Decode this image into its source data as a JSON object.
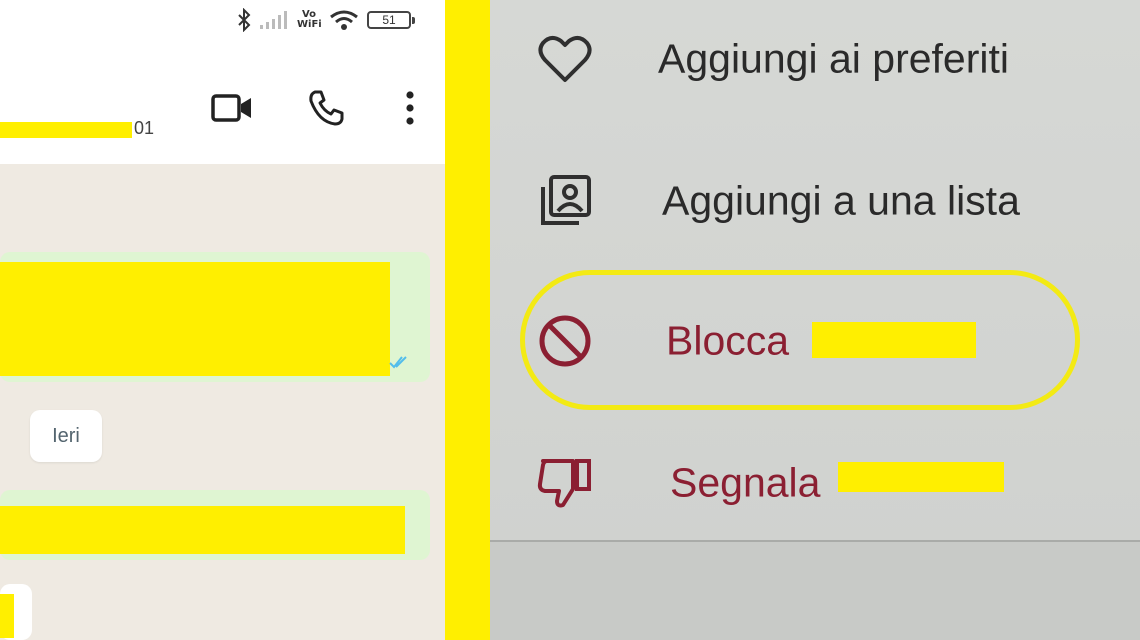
{
  "status_bar": {
    "vowifi_top": "Vo",
    "vowifi_bottom": "WiFi",
    "battery": "51"
  },
  "chat_header": {
    "contact_suffix": "01",
    "icons": [
      "videocam-icon",
      "phone-icon",
      "more-vert-icon"
    ]
  },
  "chat": {
    "date_chip": "Ieri"
  },
  "menu": {
    "items": [
      {
        "label": "Aggiungi ai preferiti",
        "icon": "heart-icon"
      },
      {
        "label": "Aggiungi a una lista",
        "icon": "add-to-list-icon"
      },
      {
        "label": "Blocca",
        "icon": "block-icon",
        "color": "#8b1f32"
      },
      {
        "label": "Segnala",
        "icon": "thumbs-down-icon",
        "color": "#8b1f32"
      }
    ]
  },
  "colors": {
    "highlight": "#ffef00",
    "chat_background": "#efeae2",
    "outgoing_bubble": "#dff5d2",
    "danger_text": "#8b1f32"
  }
}
